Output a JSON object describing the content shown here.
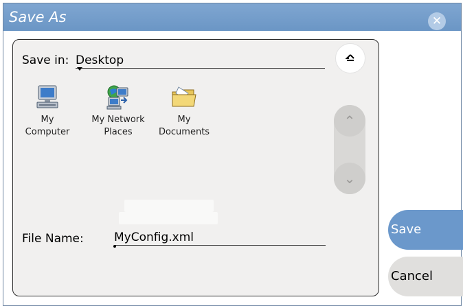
{
  "dialog": {
    "title": "Save As",
    "close_icon": "✕"
  },
  "save_in": {
    "label": "Save in:",
    "value": "Desktop",
    "up_icon": "up-folder-icon"
  },
  "files": [
    {
      "line1": "My",
      "line2": "Computer",
      "icon": "computer-icon"
    },
    {
      "line1": "My Network",
      "line2": "Places",
      "icon": "network-places-icon"
    },
    {
      "line1": "My",
      "line2": "Documents",
      "icon": "folder-icon"
    }
  ],
  "scroll": {
    "up_glyph": "⌃",
    "down_glyph": "⌄"
  },
  "file_name": {
    "label": "File Name:",
    "value": "MyConfig.xml"
  },
  "buttons": {
    "save": "Save",
    "cancel": "Cancel"
  },
  "colors": {
    "titlebar": "#6b96c5",
    "panel": "#f1f0ef",
    "save_button": "#6b98cb",
    "cancel_button": "#e0dfdd"
  }
}
